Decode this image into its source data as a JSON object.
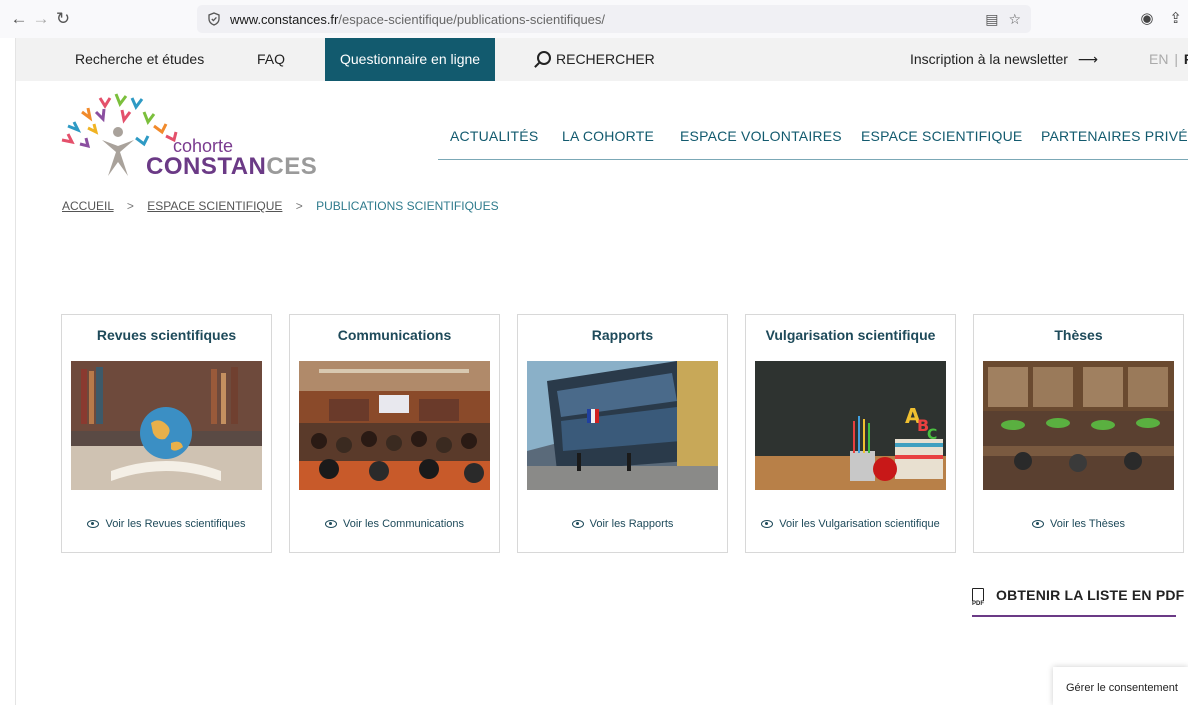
{
  "browser": {
    "url_domain": "www.constances.fr",
    "url_path": "/espace-scientifique/publications-scientifiques/"
  },
  "topbar": {
    "research": "Recherche et études",
    "faq": "FAQ",
    "questionnaire": "Questionnaire en ligne",
    "search": "RECHERCHER",
    "newsletter": "Inscription à la newsletter",
    "newsletter_arrow": "⟶",
    "lang_en": "EN",
    "lang_sep": "|",
    "lang_fr": "FR"
  },
  "logo": {
    "line1": "cohorte",
    "line2_a": "CONSTAN",
    "line2_b": "CES"
  },
  "mainnav": {
    "items": [
      "ACTUALITÉS",
      "LA COHORTE",
      "ESPACE VOLONTAIRES",
      "ESPACE SCIENTIFIQUE",
      "PARTENAIRES PRIVÉS"
    ]
  },
  "breadcrumb": {
    "home": "ACCUEIL",
    "sep": ">",
    "section": "ESPACE SCIENTIFIQUE",
    "current": "PUBLICATIONS SCIENTIFIQUES"
  },
  "cards": [
    {
      "title": "Revues scientifiques",
      "link": "Voir les Revues scientifiques"
    },
    {
      "title": "Communications",
      "link": "Voir les Communications"
    },
    {
      "title": "Rapports",
      "link": "Voir les Rapports"
    },
    {
      "title": "Vulgarisation scientifique",
      "link": "Voir les Vulgarisation scientifique"
    },
    {
      "title": "Thèses",
      "link": "Voir les Thèses"
    }
  ],
  "pdf": {
    "label": "OBTENIR LA LISTE EN PDF",
    "icon_text": "PDF"
  },
  "consent": {
    "label": "Gérer le consentement"
  },
  "colors": {
    "brand_teal": "#125a6e",
    "brand_purple": "#6b3a86"
  }
}
